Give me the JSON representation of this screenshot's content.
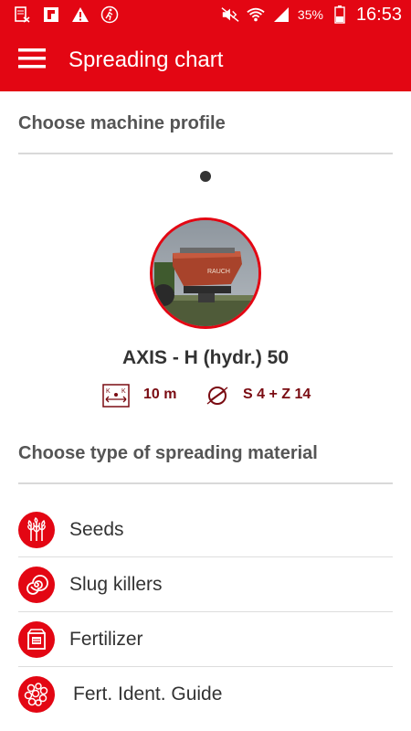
{
  "status_bar": {
    "battery_percent": "35%",
    "time": "16:53",
    "icons": [
      "notification-icon",
      "flipboard-icon",
      "warning-icon",
      "running-icon",
      "mute-icon",
      "wifi-icon",
      "signal-icon",
      "battery-icon"
    ]
  },
  "app_bar": {
    "title": "Spreading chart",
    "menu_icon": "hamburger-menu-icon"
  },
  "machine_section": {
    "heading": "Choose machine profile",
    "machine": {
      "name": "AXIS - H (hydr.) 50",
      "working_width": "10 m",
      "disc_type": "S 4 + Z 14",
      "image": "fertilizer-spreader-photo"
    }
  },
  "material_section": {
    "heading": "Choose type of spreading material",
    "items": [
      {
        "label": "Seeds",
        "icon": "seeds-icon"
      },
      {
        "label": "Slug killers",
        "icon": "slug-killer-icon"
      },
      {
        "label": "Fertilizer",
        "icon": "fertilizer-icon"
      },
      {
        "label": "Fert. Ident. Guide",
        "icon": "granules-icon"
      }
    ]
  },
  "colors": {
    "accent": "#e30613",
    "heading_text": "#555555",
    "spec_text": "#7a0b12"
  }
}
